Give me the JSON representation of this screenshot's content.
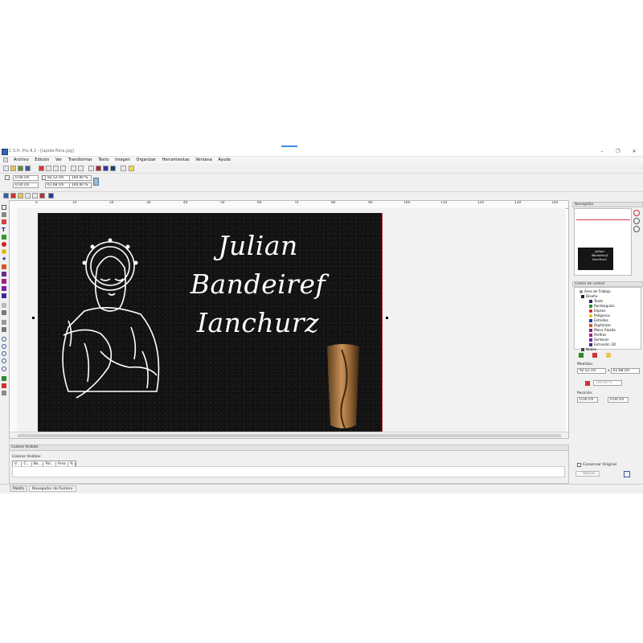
{
  "window": {
    "title": "C.S.H. Pro 8.2 - [lapida-flora.jpg]",
    "min_label": "–",
    "max_label": "❐",
    "close_label": "✕"
  },
  "menu": {
    "items": [
      "Archivo",
      "Edición",
      "Ver",
      "Transformar",
      "Texto",
      "Imagen",
      "Organizar",
      "Herramientas",
      "Ventana",
      "Ayuda"
    ]
  },
  "toolbar2": {
    "pos_x": "0.00 cm",
    "pos_y": "0.00 cm",
    "width": "92.52 cm",
    "height": "61.68 cm",
    "scale_x": "100.00 %",
    "scale_y": "100.00 %"
  },
  "ruler": {
    "labels": [
      "0",
      "10",
      "20",
      "30",
      "40",
      "50",
      "60",
      "70",
      "80",
      "90",
      "100",
      "110",
      "120",
      "130",
      "140"
    ]
  },
  "canvas": {
    "line1": "Julian",
    "line2": "Bandeiref",
    "line3": "Ianchurz",
    "plate_color": "#121212"
  },
  "bottom_panel": {
    "title": "Colores Visibles",
    "subtitle": "Colores Visibles:",
    "columns": [
      "V...",
      "C...",
      "No...",
      "Pal...",
      "Área",
      "%"
    ]
  },
  "status": {
    "tab1": "Paleta",
    "tab2": "Navegador de Puntero"
  },
  "right": {
    "nav_title": "Navegador",
    "nav_mini": {
      "l1": "Julian",
      "l2": "Bandeiref",
      "l3": "Ianchurz"
    },
    "control_title": "Centro de control",
    "tree": [
      {
        "label": "Área de Trabajo",
        "icon": "workspace-icon",
        "color": "#9a8d7c"
      },
      {
        "label": "Diseño",
        "icon": "cursor-icon",
        "color": "#222222"
      },
      {
        "label": "Texto",
        "icon": "text-icon",
        "color": "#1a2a80"
      },
      {
        "label": "Rectángulos",
        "icon": "rectangle-icon",
        "color": "#2a9a2a"
      },
      {
        "label": "Elipses",
        "icon": "ellipse-icon",
        "color": "#cc2020"
      },
      {
        "label": "Polígonos",
        "icon": "polygon-icon",
        "color": "#e6b800"
      },
      {
        "label": "Estrellas",
        "icon": "star-icon",
        "color": "#1a3a9a"
      },
      {
        "label": "Digitalizar",
        "icon": "digitize-icon",
        "color": "#d45a20"
      },
      {
        "label": "Mano Alzada",
        "icon": "freehand-icon",
        "color": "#6a2a8a"
      },
      {
        "label": "Perfiles",
        "icon": "profile-icon",
        "color": "#a02080"
      },
      {
        "label": "Sombras",
        "icon": "shadow-icon",
        "color": "#7a1fae"
      },
      {
        "label": "Extrusión 3D",
        "icon": "extrusion-icon",
        "color": "#3a2a9a"
      },
      {
        "label": "Nodos",
        "icon": "nodes-icon",
        "color": "#444444"
      }
    ],
    "measures_label": "Medidas:",
    "width": "92.52 cm",
    "height": "61.68 cm",
    "sep": "x",
    "scale": "100.00 %",
    "position_label": "Posición:",
    "pos_x": "0.00 cm",
    "pos_y": "0.00 cm",
    "keep_label": "Conservar Original",
    "apply_label": "Aplicar"
  }
}
